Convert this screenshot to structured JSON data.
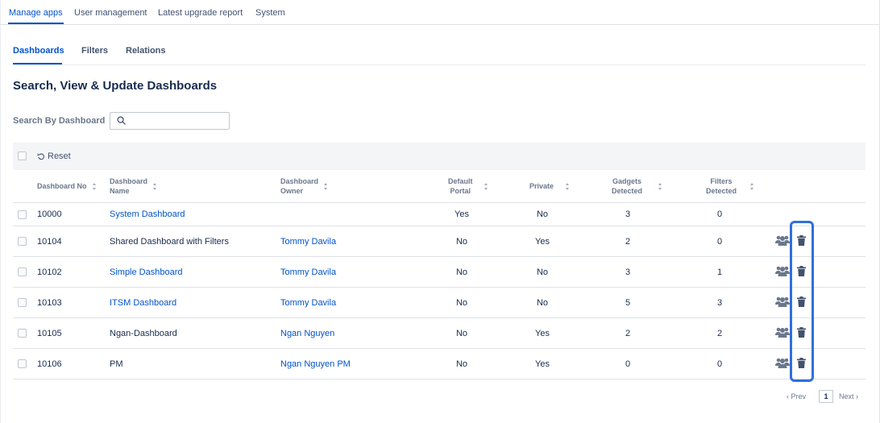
{
  "top_nav": {
    "tabs": [
      {
        "label": "Manage apps"
      },
      {
        "label": "User management"
      },
      {
        "label": "Latest upgrade report"
      },
      {
        "label": "System"
      }
    ],
    "active": "Manage apps"
  },
  "sub_nav": {
    "tabs": [
      {
        "label": "Dashboards"
      },
      {
        "label": "Filters"
      },
      {
        "label": "Relations"
      }
    ],
    "active": "Dashboards"
  },
  "page_title": "Search, View & Update Dashboards",
  "search": {
    "label": "Search By Dashboard",
    "value": "",
    "placeholder": ""
  },
  "toolbar": {
    "reset_label": "Reset"
  },
  "table": {
    "columns": [
      {
        "label": "Dashboard No",
        "sortable": true
      },
      {
        "label": "Dashboard\nName",
        "sortable": true
      },
      {
        "label": "Dashboard\nOwner",
        "sortable": true
      },
      {
        "label": "Default\nPortal",
        "sortable": true
      },
      {
        "label": "Private",
        "sortable": true
      },
      {
        "label": "Gadgets\nDetected",
        "sortable": true
      },
      {
        "label": "Filters\nDetected",
        "sortable": true
      }
    ],
    "rows": [
      {
        "no": "10000",
        "name": "System Dashboard",
        "name_link": true,
        "owner": "",
        "portal": "Yes",
        "private": "No",
        "gadgets": "3",
        "filters": "0",
        "actions": false
      },
      {
        "no": "10104",
        "name": "Shared Dashboard with Filters",
        "name_link": false,
        "owner": "Tommy Davila",
        "portal": "No",
        "private": "Yes",
        "gadgets": "2",
        "filters": "0",
        "actions": true
      },
      {
        "no": "10102",
        "name": "Simple Dashboard",
        "name_link": true,
        "owner": "Tommy Davila",
        "portal": "No",
        "private": "No",
        "gadgets": "3",
        "filters": "1",
        "actions": true
      },
      {
        "no": "10103",
        "name": "ITSM Dashboard",
        "name_link": true,
        "owner": "Tommy Davila",
        "portal": "No",
        "private": "No",
        "gadgets": "5",
        "filters": "3",
        "actions": true
      },
      {
        "no": "10105",
        "name": "Ngan-Dashboard",
        "name_link": false,
        "owner": "Ngan Nguyen",
        "portal": "No",
        "private": "Yes",
        "gadgets": "2",
        "filters": "2",
        "actions": true
      },
      {
        "no": "10106",
        "name": "PM",
        "name_link": false,
        "owner": "Ngan Nguyen PM",
        "portal": "No",
        "private": "Yes",
        "gadgets": "0",
        "filters": "0",
        "actions": true
      }
    ],
    "action_icons": [
      "share-users-icon",
      "trash-icon"
    ]
  },
  "pagination": {
    "prev_label": "Prev",
    "current_page": "1",
    "next_label": "Next"
  },
  "colors": {
    "link": "#0052cc",
    "highlight": "#2f6fde",
    "text": "#172b4d",
    "muted": "#6b778c"
  }
}
